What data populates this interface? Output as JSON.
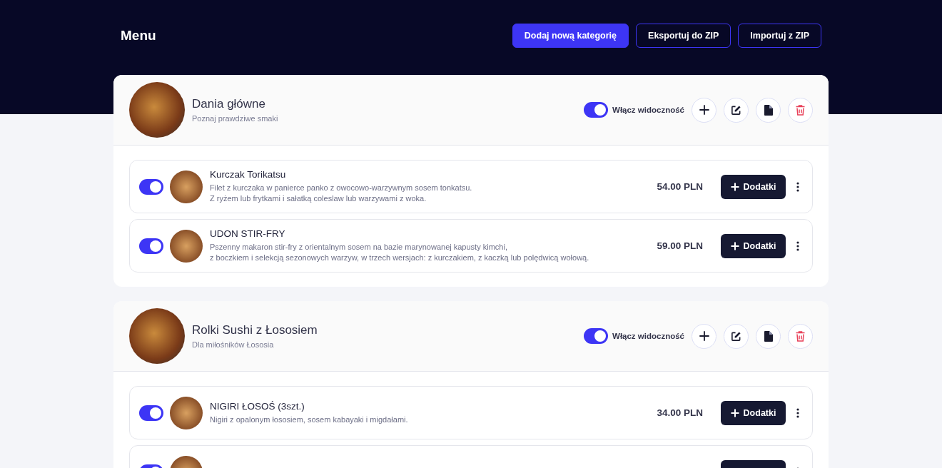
{
  "page_title": "Menu",
  "header_buttons": [
    {
      "label": "Dodaj nową kategorię",
      "kind": "primary"
    },
    {
      "label": "Eksportuj do ZIP",
      "kind": "outline"
    },
    {
      "label": "Importuj z ZIP",
      "kind": "outline"
    }
  ],
  "categories": [
    {
      "title": "Dania główne",
      "subtitle": "Poznaj prawdziwe smaki",
      "visible": true,
      "visibility_label": "Włącz widoczność",
      "items": [
        {
          "name": "Kurczak Torikatsu",
          "description": [
            "Filet z kurczaka w panierce panko z owocowo-warzywnym sosem tonkatsu.",
            "Z ryżem lub frytkami i sałatką coleslaw lub warzywami z woka."
          ],
          "price": "54.00 PLN",
          "visible": true,
          "button": "Dodatki"
        },
        {
          "name": "UDON STIR-FRY",
          "description": [
            "Pszenny makaron stir-fry z orientalnym sosem na bazie marynowanej kapusty kimchi,",
            "z boczkiem i selekcją sezonowych warzyw, w trzech wersjach: z kurczakiem, z kaczką lub polędwicą wołową."
          ],
          "price": "59.00 PLN",
          "visible": true,
          "button": "Dodatki"
        }
      ]
    },
    {
      "title": "Rolki Sushi z Łososiem",
      "subtitle": "Dla miłośników Łososia",
      "visible": true,
      "visibility_label": "Włącz widoczność",
      "items": [
        {
          "name": "NIGIRI ŁOSOŚ (3szt.)",
          "description": [
            "Nigiri z opalonym łososiem, sosem kabayaki i migdałami."
          ],
          "price": "34.00 PLN",
          "visible": true,
          "button": "Dodatki"
        },
        {
          "visible": true
        }
      ]
    }
  ]
}
